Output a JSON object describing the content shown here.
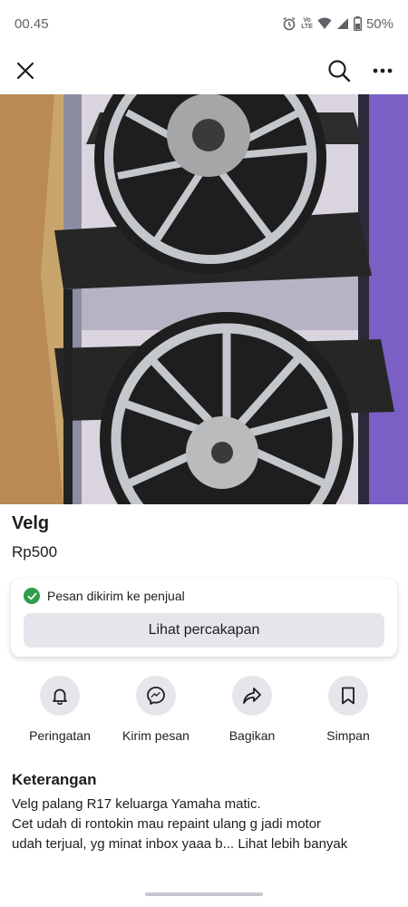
{
  "status_bar": {
    "time": "00.45",
    "battery": "50%",
    "network": "LTE"
  },
  "nav": {
    "close_icon": "close-icon",
    "search_icon": "search-icon",
    "more_icon": "more-icon"
  },
  "listing": {
    "title": "Velg",
    "price": "Rp500",
    "photo_description": "two motorcycle alloy wheels on metal stand"
  },
  "message_card": {
    "sent_text": "Pesan dikirim ke penjual",
    "view_button": "Lihat percakapan"
  },
  "actions": [
    {
      "label": "Peringatan",
      "icon": "bell-icon"
    },
    {
      "label": "Kirim pesan",
      "icon": "messenger-icon"
    },
    {
      "label": "Bagikan",
      "icon": "share-icon"
    },
    {
      "label": "Simpan",
      "icon": "bookmark-icon"
    }
  ],
  "description": {
    "heading": "Keterangan",
    "line1": "Velg palang R17 keluarga Yamaha matic.",
    "line2": "Cet udah di rontokin mau repaint ulang g jadi motor",
    "line3": "udah terjual, yg minat inbox yaaa b...",
    "see_more": "Lihat lebih banyak"
  },
  "colors": {
    "success": "#2e9d4c",
    "button_bg": "#e4e6eb",
    "text": "#1c1e21"
  }
}
